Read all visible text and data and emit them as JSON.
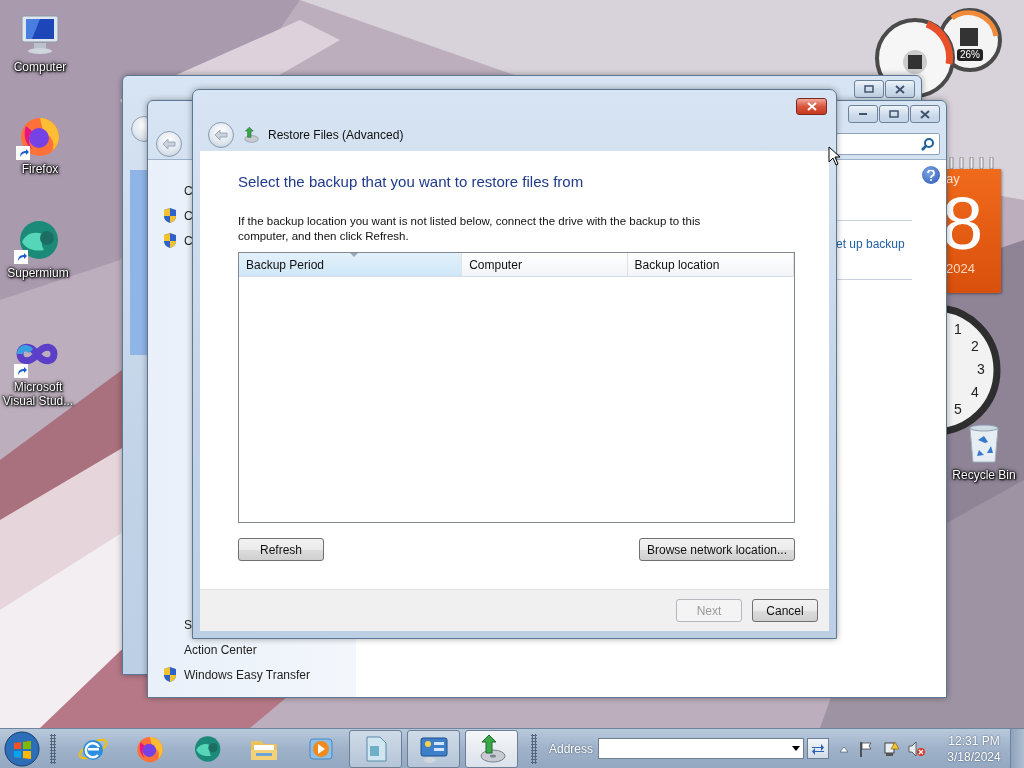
{
  "desktop_icons": [
    {
      "label": "Computer",
      "kind": "computer",
      "shortcut": false
    },
    {
      "label": "Firefox",
      "kind": "firefox",
      "shortcut": true
    },
    {
      "label": "Supermium",
      "kind": "supermium",
      "shortcut": true
    },
    {
      "label": "Microsoft Visual Stud...",
      "kind": "visual-studio",
      "shortcut": true
    }
  ],
  "gadgets": {
    "cpu": {
      "reading": "26%"
    },
    "calendar": {
      "weekday": "ay",
      "day": "8",
      "year": "2024"
    },
    "clock": {
      "numerals": [
        "1",
        "2",
        "3",
        "4",
        "5"
      ]
    },
    "recycle_bin": {
      "label": "Recycle Bin"
    }
  },
  "control_panel_window": {
    "link": "et up backup",
    "sidebar_top": [
      {
        "label": "C",
        "shield": false
      },
      {
        "label": "C",
        "shield": true
      },
      {
        "label": "C",
        "shield": true
      }
    ],
    "sidebar_bottom": [
      {
        "label": "S",
        "shield": false
      },
      {
        "label": "Action Center",
        "shield": false
      },
      {
        "label": "Windows Easy Transfer",
        "shield": true
      }
    ]
  },
  "dialog": {
    "title": "Restore Files (Advanced)",
    "heading": "Select the backup that you want to restore files from",
    "description": "If the backup location you want is not listed below, connect the drive with the backup to this computer, and then click Refresh.",
    "table": {
      "columns": [
        {
          "label": "Backup Period",
          "sorted": true
        },
        {
          "label": "Computer",
          "sorted": false
        },
        {
          "label": "Backup location",
          "sorted": false
        }
      ]
    },
    "actions": [
      {
        "label": "Refresh"
      },
      {
        "label": "Browse network location..."
      }
    ],
    "footer_buttons": [
      {
        "label": "Next",
        "disabled": true
      },
      {
        "label": "Cancel",
        "disabled": false
      }
    ]
  },
  "taskbar": {
    "items": [
      {
        "kind": "ie",
        "running": false,
        "selected": false
      },
      {
        "kind": "firefox",
        "running": false,
        "selected": false
      },
      {
        "kind": "supermium",
        "running": false,
        "selected": false
      },
      {
        "kind": "folder",
        "running": false,
        "selected": false
      },
      {
        "kind": "media",
        "running": false,
        "selected": false
      },
      {
        "kind": "document",
        "running": true,
        "selected": false
      },
      {
        "kind": "control-panel",
        "running": true,
        "selected": false
      },
      {
        "kind": "backup",
        "running": true,
        "selected": true
      }
    ],
    "address": {
      "label": "Address"
    },
    "clock": {
      "time": "12:31 PM",
      "date": "3/18/2024"
    }
  }
}
